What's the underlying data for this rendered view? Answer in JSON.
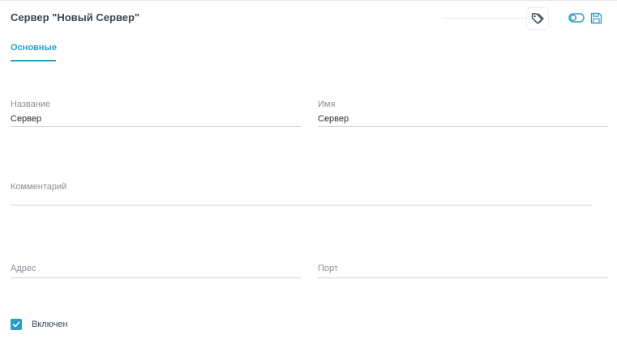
{
  "header": {
    "title": "Сервер \"Новый Сервер\"",
    "tag_icon": "tag-icon",
    "toggle_icon": "toggle-icon",
    "save_icon": "save-icon"
  },
  "tabs": [
    {
      "label": "Основные",
      "active": true
    }
  ],
  "form": {
    "name": {
      "label": "Название",
      "value": "Сервер"
    },
    "username": {
      "label": "Имя",
      "value": "Сервер"
    },
    "comment": {
      "label": "Комментарий",
      "value": ""
    },
    "address": {
      "label": "Адрес",
      "value": ""
    },
    "port": {
      "label": "Порт",
      "value": ""
    },
    "enabled": {
      "label": "Включен",
      "checked": true
    }
  },
  "colors": {
    "accent": "#2a9bc4",
    "title": "#3c4650",
    "label": "#8a8f94",
    "divider": "#cfd3d6"
  }
}
